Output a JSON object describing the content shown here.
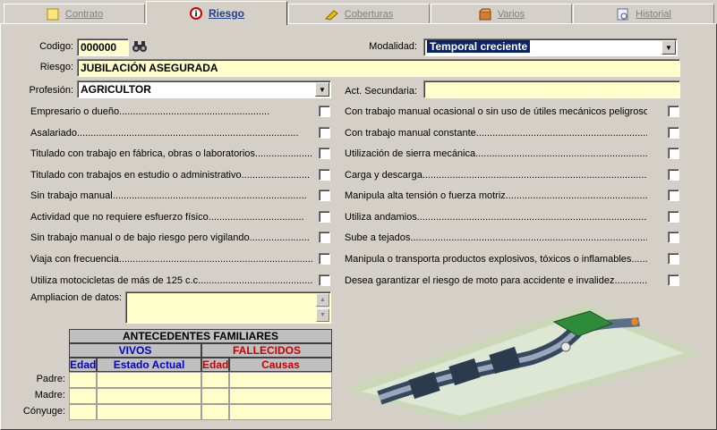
{
  "tabs": [
    {
      "label": "Contrato",
      "icon": "contract-icon",
      "active": false
    },
    {
      "label": "Riesgo",
      "icon": "risk-icon",
      "active": true
    },
    {
      "label": "Coberturas",
      "icon": "coverage-icon",
      "active": false
    },
    {
      "label": "Varios",
      "icon": "box-icon",
      "active": false
    },
    {
      "label": "Historial",
      "icon": "history-icon",
      "active": false
    }
  ],
  "form": {
    "codigo_label": "Codigo:",
    "codigo_value": "000000",
    "modalidad_label": "Modalidad:",
    "modalidad_value": "Temporal creciente",
    "riesgo_label": "Riesgo:",
    "riesgo_value": "JUBILACIÓN ASEGURADA",
    "profesion_label": "Profesión:",
    "profesion_value": "AGRICULTOR",
    "act_secundaria_label": "Act. Secundaria:",
    "act_secundaria_value": "",
    "ampliacion_label": "Ampliacion de datos:",
    "ampliacion_value": ""
  },
  "left_checks": [
    "Empresario o dueño.......................................................",
    "Asalariado.................................................................................",
    "Titulado con trabajo en fábrica, obras o laboratorios.....................",
    "Titulado con trabajos en estudio o administrativo.........................",
    "Sin trabajo manual.......................................................................",
    "Actividad que no requiere esfuerzo físico...................................",
    "Sin trabajo manual o de bajo riesgo pero vigilando......................",
    "Viaja con frecuencia........................................................................",
    "Utiliza motocicletas de más de 125 c.c..........................................."
  ],
  "right_checks": [
    "Con trabajo manual ocasional o sin uso de útiles mecánicos peligrosos..",
    "Con trabajo manual constante..................................................................",
    "Utilización de sierra mecánica..................................................................",
    "Carga y descarga.........................................................................................",
    "Manipula alta tensión o fuerza motriz.......................................................",
    "Utiliza andamios..........................................................................................",
    "Sube a tejados..............................................................................................",
    "Manipula o transporta productos explosivos, tóxicos o inflamables..........",
    "Desea garantizar el riesgo de moto para accidente e invalidez..............."
  ],
  "family": {
    "title": "ANTECEDENTES FAMILIARES",
    "vivos": "VIVOS",
    "fallecidos": "FALLECIDOS",
    "col_edad": "Edad",
    "col_estado": "Estado Actual",
    "col_edad2": "Edad",
    "col_causas": "Causas",
    "rows": [
      "Padre:",
      "Madre:",
      "Cónyuge:"
    ]
  },
  "colors": {
    "field_bg": "#ffffcc",
    "vivos": "#0000cc",
    "fallecidos": "#cc0000",
    "active_tab_text": "#1f3f8f",
    "selection": "#0a246a"
  }
}
